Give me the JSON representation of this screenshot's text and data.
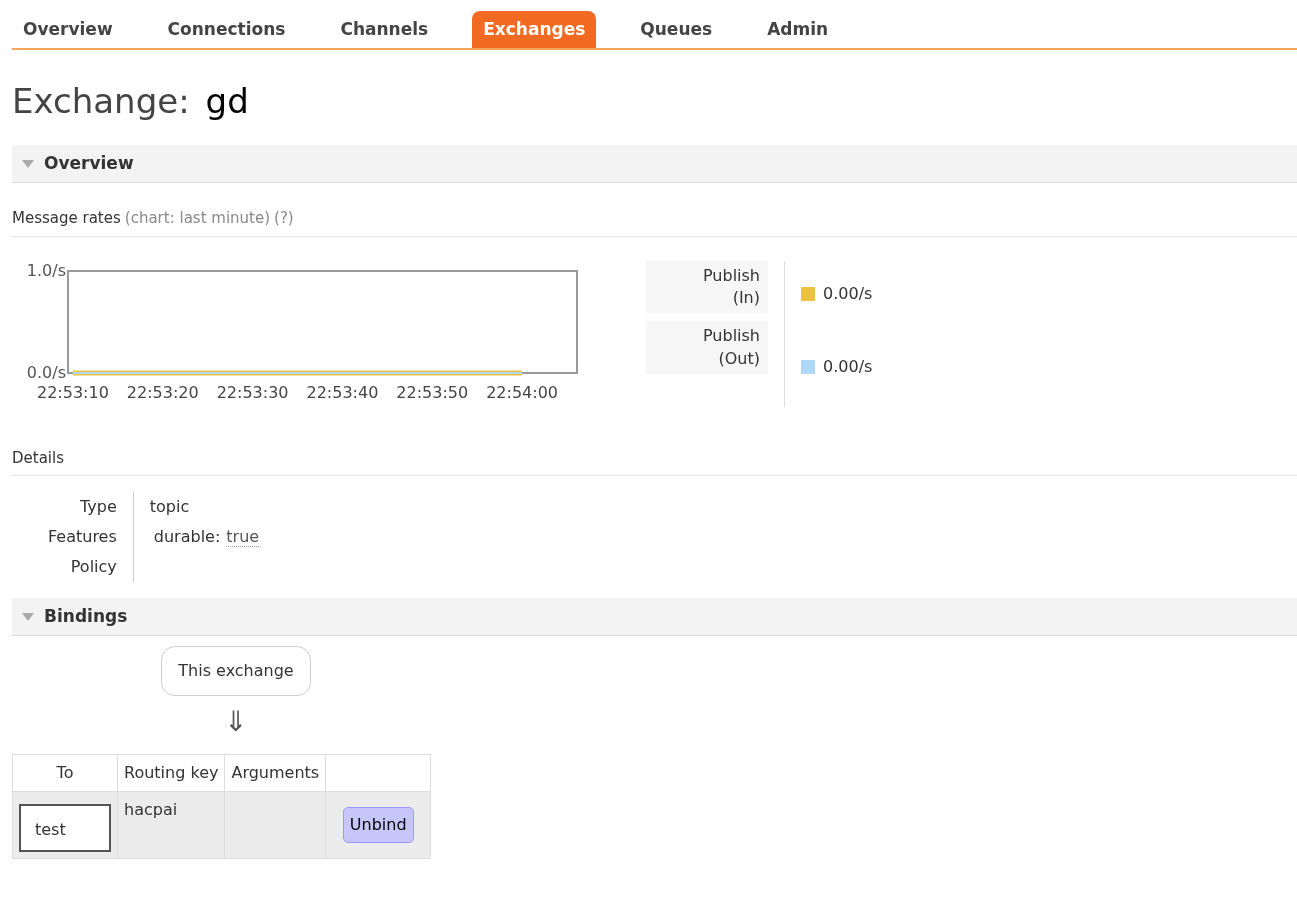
{
  "tabs": [
    {
      "label": "Overview",
      "selected": false
    },
    {
      "label": "Connections",
      "selected": false
    },
    {
      "label": "Channels",
      "selected": false
    },
    {
      "label": "Exchanges",
      "selected": true
    },
    {
      "label": "Queues",
      "selected": false
    },
    {
      "label": "Admin",
      "selected": false
    }
  ],
  "page_title": {
    "prefix": "Exchange:",
    "name": "gd"
  },
  "overview_section": {
    "title": "Overview",
    "expanded": true,
    "message_rates": {
      "label": "Message rates",
      "hint": "(chart: last minute)",
      "help": "(?)",
      "chart_data": {
        "type": "line",
        "categories": [
          "22:53:10",
          "22:53:20",
          "22:53:30",
          "22:53:40",
          "22:53:50",
          "22:54:00"
        ],
        "ylim": [
          0,
          1
        ],
        "yticks": [
          {
            "value": 0,
            "label": "0.0/s"
          },
          {
            "value": 1,
            "label": "1.0/s"
          }
        ],
        "series": [
          {
            "name": "Publish (In)",
            "color": "#edc240",
            "values": [
              0,
              0,
              0,
              0,
              0,
              0
            ]
          },
          {
            "name": "Publish (Out)",
            "color": "#afd8f8",
            "values": [
              0,
              0,
              0,
              0,
              0,
              0
            ]
          }
        ]
      },
      "legend_rates": [
        "0.00/s",
        "0.00/s"
      ]
    },
    "details": {
      "title": "Details",
      "rows": [
        {
          "label": "Type",
          "value": "topic"
        },
        {
          "label": "Features",
          "value": "durable:",
          "link": "true"
        },
        {
          "label": "Policy"
        }
      ]
    }
  },
  "bindings_section": {
    "title": "Bindings",
    "expanded": true,
    "source": "This exchange",
    "arrow": "⇓",
    "table": {
      "columns": [
        "To",
        "Routing key",
        "Arguments"
      ],
      "rows": [
        {
          "to": "test",
          "routing_key": "hacpai",
          "action": "Unbind"
        }
      ]
    }
  }
}
